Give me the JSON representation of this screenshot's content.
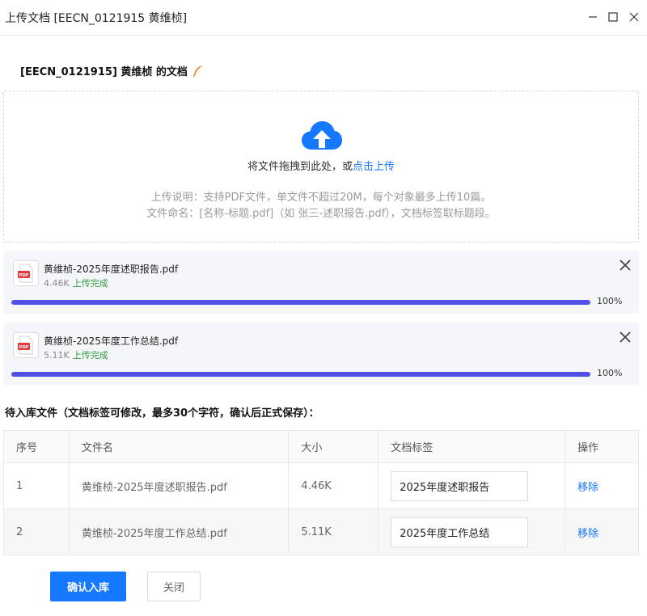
{
  "window": {
    "title": "上传文档 [EECN_0121915 黄维桢]",
    "minimize_icon": "minimize-icon",
    "maximize_icon": "maximize-icon",
    "close_icon": "close-icon"
  },
  "heading": {
    "text": "[EECN_0121915] 黄维桢 的文档",
    "icon": "feather-icon",
    "icon_color": "#f5821f"
  },
  "dropzone": {
    "icon": "cloud-upload-icon",
    "icon_color": "#1677ff",
    "text_prefix": "将文件拖拽到此处，或",
    "link_text": "点击上传",
    "hint_line1": "上传说明：支持PDF文件，单文件不超过20M，每个对象最多上传10篇。",
    "hint_line2": "文件命名：[名称-标题.pdf]（如 张三-述职报告.pdf），文档标签取标题段。"
  },
  "uploads": [
    {
      "name": "黄维桢-2025年度述职报告.pdf",
      "size": "4.46K",
      "status": "上传完成",
      "progress_label": "100%",
      "progress": 1.0,
      "icon": "pdf-file-icon"
    },
    {
      "name": "黄维桢-2025年度工作总结.pdf",
      "size": "5.11K",
      "status": "上传完成",
      "progress_label": "100%",
      "progress": 1.0,
      "icon": "pdf-file-icon"
    }
  ],
  "pending": {
    "label": "待入库文件（文档标签可修改，最多30个字符，确认后正式保存）：",
    "columns": [
      "序号",
      "文件名",
      "大小",
      "文档标签",
      "操作"
    ],
    "rows": [
      {
        "index": "1",
        "filename": "黄维桢-2025年度述职报告.pdf",
        "size": "4.46K",
        "tag": "2025年度述职报告",
        "action": "移除"
      },
      {
        "index": "2",
        "filename": "黄维桢-2025年度工作总结.pdf",
        "size": "5.11K",
        "tag": "2025年度工作总结",
        "action": "移除"
      }
    ]
  },
  "buttons": {
    "confirm": "确认入库",
    "close": "关闭"
  },
  "colors": {
    "accent": "#1677ff",
    "progress": "#5150e6",
    "success": "#2e9d3d"
  }
}
